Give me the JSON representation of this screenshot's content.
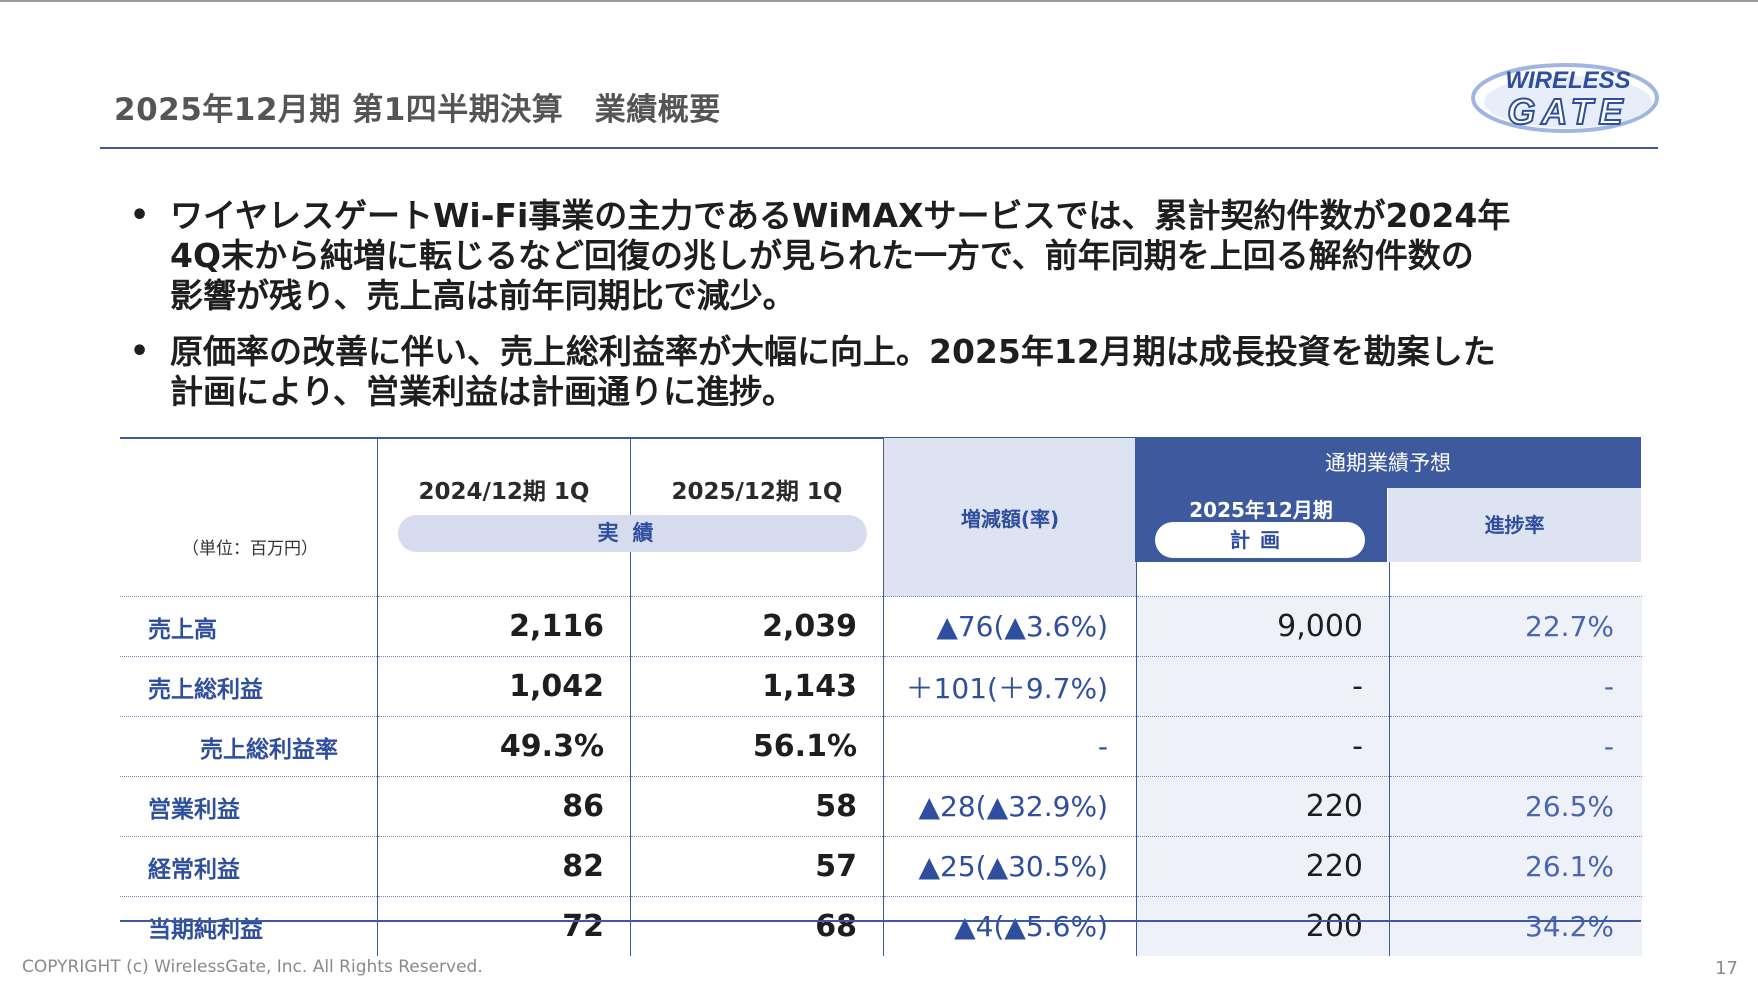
{
  "header": {
    "title": "2025年12月期 第1四半期決算　業績概要",
    "logo_line1": "WIRELESS",
    "logo_line2": "GATE"
  },
  "bullets": [
    "ワイヤレスゲートWi-Fi事業の主力であるWiMAXサービスでは、累計契約件数が2024年\n4Q末から純増に転じるなど回復の兆しが見られた一方で、前年同期を上回る解約件数の\n影響が残り、売上高は前年同期比で減少。",
    "原価率の改善に伴い、売上総利益率が大幅に向上。2025年12月期は成長投資を勘案した\n計画により、営業利益は計画通りに進捗。"
  ],
  "table": {
    "unit": "（単位：百万円）",
    "col_prev": "2024/12期 1Q",
    "col_cur": "2025/12期 1Q",
    "actual_label": "実績",
    "col_diff": "増減額(率)",
    "forecast_header": "通期業績予想",
    "plan_year": "2025年12月期",
    "plan_label": "計画",
    "progress_label": "進捗率",
    "rows": [
      {
        "label": "売上高",
        "prev": "2,116",
        "cur": "2,039",
        "diff": "▲76(▲3.6%)",
        "plan": "9,000",
        "progress": "22.7%"
      },
      {
        "label": "売上総利益",
        "prev": "1,042",
        "cur": "1,143",
        "diff": "＋101(＋9.7%)",
        "plan": "-",
        "progress": "-"
      },
      {
        "label": "売上総利益率",
        "prev": "49.3%",
        "cur": "56.1%",
        "diff": "-",
        "plan": "-",
        "progress": "-"
      },
      {
        "label": "営業利益",
        "prev": "86",
        "cur": "58",
        "diff": "▲28(▲32.9%)",
        "plan": "220",
        "progress": "26.5%"
      },
      {
        "label": "経常利益",
        "prev": "82",
        "cur": "57",
        "diff": "▲25(▲30.5%)",
        "plan": "220",
        "progress": "26.1%"
      },
      {
        "label": "当期純利益",
        "prev": "72",
        "cur": "68",
        "diff": "▲4(▲5.6%)",
        "plan": "200",
        "progress": "34.2%"
      }
    ]
  },
  "footer": {
    "copyright": "COPYRIGHT (c) WirelessGate, Inc. All Rights Reserved.",
    "page": "17"
  },
  "colors": {
    "accent": "#3e5a9e",
    "label_blue": "#2f4f9e",
    "pill_bg": "#d6dcee"
  }
}
